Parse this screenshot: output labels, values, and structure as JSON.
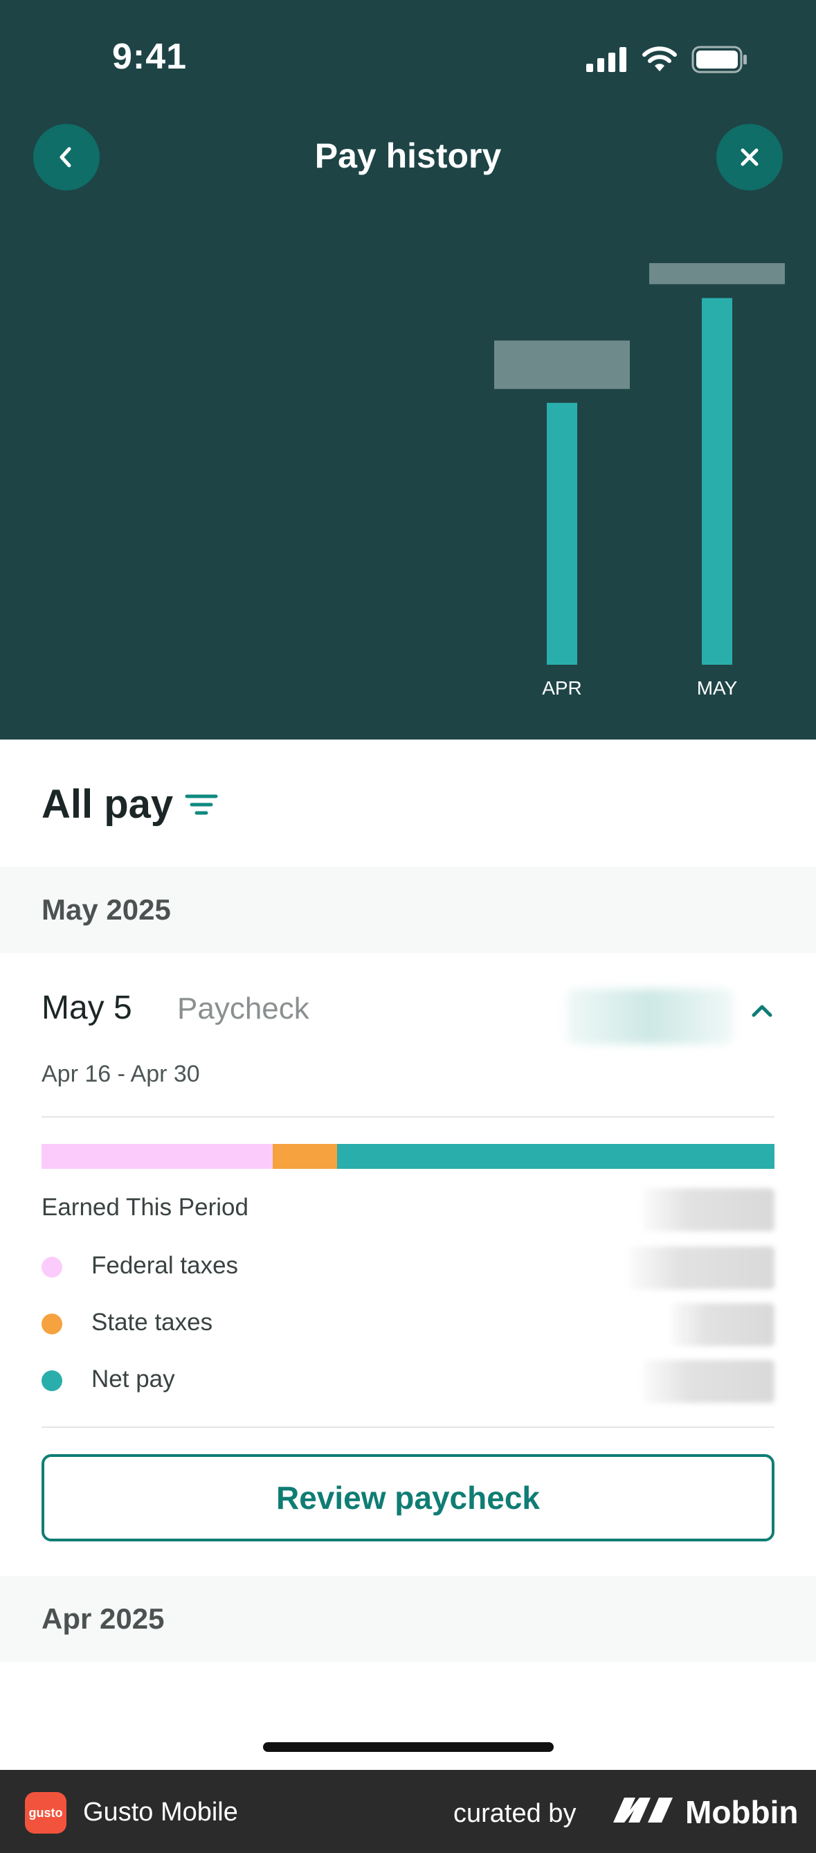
{
  "status_bar": {
    "time": "9:41"
  },
  "header": {
    "title": "Pay history"
  },
  "chart_data": {
    "type": "bar",
    "categories": [
      "APR",
      "MAY"
    ],
    "values": [
      300,
      420
    ],
    "ylim": [
      0,
      460
    ],
    "grid": false,
    "bar_color": "#2aaeac",
    "label_bg": "rgba(176,196,196,0.55)"
  },
  "filter": {
    "title": "All pay"
  },
  "sections": [
    {
      "label": "May 2025"
    },
    {
      "label": "Apr 2025"
    }
  ],
  "paycheck": {
    "date": "May 5",
    "type": "Paycheck",
    "range": "Apr 16 - Apr 30",
    "breakdown_fractions": [
      {
        "key": "federal",
        "fraction": 0.315,
        "color": "#fbccfb"
      },
      {
        "key": "state",
        "fraction": 0.088,
        "color": "#f6a23e"
      },
      {
        "key": "net",
        "fraction": 0.597,
        "color": "#2aaeac"
      }
    ],
    "earned_label": "Earned This Period",
    "items": [
      {
        "label": "Federal taxes",
        "color": "#fbccfb"
      },
      {
        "label": "State taxes",
        "color": "#f6a23e"
      },
      {
        "label": "Net pay",
        "color": "#2aaeac"
      }
    ],
    "review_button": "Review paycheck"
  },
  "footer": {
    "app_logo_text": "gusto",
    "app_name": "Gusto Mobile",
    "curated_by": "curated by",
    "brand": "Mobbin"
  },
  "colors": {
    "header_bg": "#1e4446",
    "accent": "#0f7d74",
    "nav_btn": "#0f6e67"
  }
}
